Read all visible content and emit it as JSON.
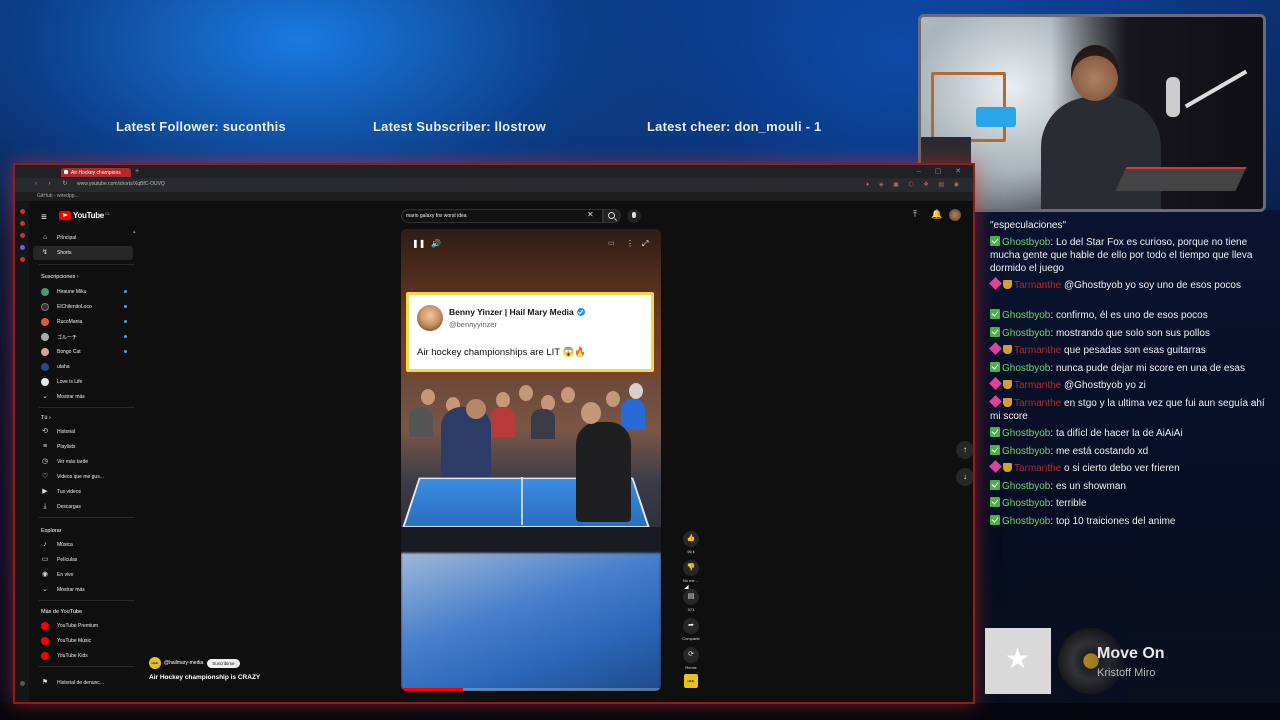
{
  "ticker": {
    "follower": "Latest Follower: suconthis",
    "subscriber": "Latest Subscriber: llostrow",
    "cheer": "Latest cheer: don_mouli - 1"
  },
  "browser": {
    "tab_title": "Air Hockey champions",
    "new_tab": "+",
    "window_controls": "– ▢ ✕",
    "nav": "‹ › ↻",
    "url": "www.youtube.com/shorts/XqBfC-OUVQ",
    "bookmark": "GitHub - wiredpp...",
    "extensions": "♦ ◈ ▣ ⬡ ❖ ▤ ◉"
  },
  "youtube": {
    "logo": "YouTube",
    "logo_cc": "CL",
    "search_value": "mario galaxy fox worst idea",
    "sidebar": {
      "main": [
        {
          "label": "Principal",
          "icon": "home-icon",
          "glyph": "⌂"
        },
        {
          "label": "Shorts",
          "icon": "shorts-icon",
          "glyph": "↯"
        }
      ],
      "subscriptions_header": "Suscripciones  ›",
      "subscriptions": [
        {
          "label": "Hiraune Miku",
          "color": "#4a9a6a"
        },
        {
          "label": "ElChilenitoLoco",
          "color": "#333333"
        },
        {
          "label": "RucoMania",
          "color": "#e05a2a"
        },
        {
          "label": "ゴルーチ",
          "color": "#aaaaaa"
        },
        {
          "label": "Bongo Cat",
          "color": "#d8a0a0"
        },
        {
          "label": "utaha",
          "color": "#2a4a8a"
        },
        {
          "label": "Love is Life",
          "color": "#e8e8e8"
        }
      ],
      "show_more_1": "Mostrar más",
      "you_header": "Tú  ›",
      "you_items": [
        {
          "label": "Historial",
          "glyph": "⟲"
        },
        {
          "label": "Playlists",
          "glyph": "≡"
        },
        {
          "label": "Ver más tarde",
          "glyph": "◷"
        },
        {
          "label": "Videos que me gus...",
          "glyph": "♡"
        },
        {
          "label": "Tus videos",
          "glyph": "▶"
        },
        {
          "label": "Descargas",
          "glyph": "⤓"
        }
      ],
      "explore_header": "Explorar",
      "explore_items": [
        {
          "label": "Música",
          "glyph": "♪"
        },
        {
          "label": "Películas",
          "glyph": "▭"
        },
        {
          "label": "En vivo",
          "glyph": "◉"
        }
      ],
      "show_more_2": "Mostrar más",
      "more_header": "Más de YouTube",
      "more_items": [
        {
          "label": "YouTube Premium"
        },
        {
          "label": "YouTube Music"
        },
        {
          "label": "YouTube Kids"
        }
      ],
      "report": "Historial de denunc..."
    },
    "short": {
      "tweet_name": "Benny Yinzer | Hail Mary Media",
      "tweet_handle": "@bennyyinzer",
      "tweet_text": "Air hockey championships are LIT 😱🔥",
      "progress": 0.24
    },
    "actions": {
      "like": "96 k",
      "dislike": "No me ...",
      "comments": "971",
      "share": "Compartir",
      "remix": "Remix",
      "thumb_text": "HAIL"
    },
    "channel": {
      "avatar_text": "HAIL",
      "name": "@hailmary-media",
      "subscribe": "Suscribirse"
    },
    "video_title": "Air Hockey championship is CRAZY"
  },
  "chat": [
    {
      "user": "",
      "msg": "\"especulaciones\""
    },
    {
      "user": "Ghostbyob",
      "msg": "Lo del Star Fox es curioso, porque no tiene mucha gente que hable de ello por todo el tiempo que lleva dormido el juego"
    },
    {
      "user": "Tarmanthe",
      "msg": "@Ghostbyob yo soy uno de esos pocos"
    },
    {
      "user": "Ghostbyob",
      "msg": "confirmo, él es uno de esos pocos"
    },
    {
      "user": "Ghostbyob",
      "msg": "mostrando que solo son sus pollos"
    },
    {
      "user": "Tarmanthe",
      "msg": "que pesadas son esas guitarras"
    },
    {
      "user": "Ghostbyob",
      "msg": "nunca pude dejar mi score en una de esas"
    },
    {
      "user": "Tarmanthe",
      "msg": "@Ghostbyob yo zi"
    },
    {
      "user": "Tarmanthe",
      "msg": "en stgo y la ultima vez que fui aun seguía ahí mi score"
    },
    {
      "user": "Ghostbyob",
      "msg": "ta difícl de hacer la de AiAiAi"
    },
    {
      "user": "Ghostbyob",
      "msg": "me está costando xd"
    },
    {
      "user": "Tarmanthe",
      "msg": "o si cierto debo ver frieren"
    },
    {
      "user": "Ghostbyob",
      "msg": "es un showman"
    },
    {
      "user": "Ghostbyob",
      "msg": "terrible"
    },
    {
      "user": "Ghostbyob",
      "msg": "top 10 traiciones del anime"
    }
  ],
  "now_playing": {
    "title": "Move On",
    "artist": "Kristoff Miro"
  },
  "colors": {
    "accent_red": "#b02a2a",
    "youtube_red": "#ff0000",
    "chat_green": "#6fd36f"
  }
}
